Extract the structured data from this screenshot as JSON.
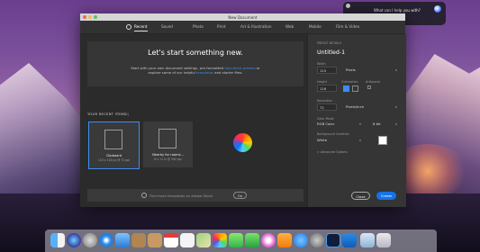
{
  "window": {
    "title": "New Document"
  },
  "siri": {
    "prompt": "What can I help you with?"
  },
  "tabs": [
    {
      "label": "Recent"
    },
    {
      "label": "Saved"
    },
    {
      "label": "Photo"
    },
    {
      "label": "Print"
    },
    {
      "label": "Art & Illustration"
    },
    {
      "label": "Web"
    },
    {
      "label": "Mobile"
    },
    {
      "label": "Film & Video"
    }
  ],
  "hero": {
    "heading": "Let's start something new.",
    "line1_pre": "Start with your own document settings, pre-formatted ",
    "line1_link": "document presets",
    "line1_post": " or",
    "line2_pre": "explore some of our helpful ",
    "line2_link": "templates",
    "line2_post": " and starter files."
  },
  "recent": {
    "label": "YOUR RECENT ITEMS",
    "count": "(2)",
    "items": [
      {
        "name": "Clipboard",
        "meta": "115 x 116 px @ 72 ppi"
      },
      {
        "name": "Nearby for rooms...",
        "meta": "8 x 11 in @ 300 ppi"
      }
    ]
  },
  "search": {
    "placeholder": "Find more templates on Adobe Stock",
    "go": "Go"
  },
  "preset": {
    "section_label": "PRESET DETAILS",
    "name": "Untitled-1",
    "width_label": "Width",
    "width_value": "115",
    "width_unit": "Pixels",
    "height_label": "Height",
    "height_value": "116",
    "orientation_label": "Orientation",
    "artboards_label": "Artboards",
    "resolution_label": "Resolution",
    "resolution_value": "72",
    "resolution_unit": "Pixels/Inch",
    "color_mode_label": "Color Mode",
    "color_mode": "RGB Color",
    "bit_depth": "8 bit",
    "background_label": "Background Contents",
    "background": "White",
    "advanced": "> Advanced Options"
  },
  "buttons": {
    "close": "Close",
    "create": "Create"
  },
  "colors": {
    "accent": "#1473e6",
    "selection": "#3b8ef0",
    "panel": "#353535",
    "bg": "#2b2b2b"
  },
  "dock_icons": [
    "finder-icon",
    "siri-icon",
    "launchpad-icon",
    "safari-icon",
    "mail-icon",
    "notes-icon",
    "contacts-icon",
    "calendar-icon",
    "reminders-icon",
    "maps-icon",
    "photos-icon",
    "messages-icon",
    "facetime-icon",
    "itunes-icon",
    "ibooks-icon",
    "appstore-icon",
    "preferences-icon",
    "photoshop-icon",
    "outlook-icon",
    "downloads-icon",
    "trash-icon"
  ]
}
